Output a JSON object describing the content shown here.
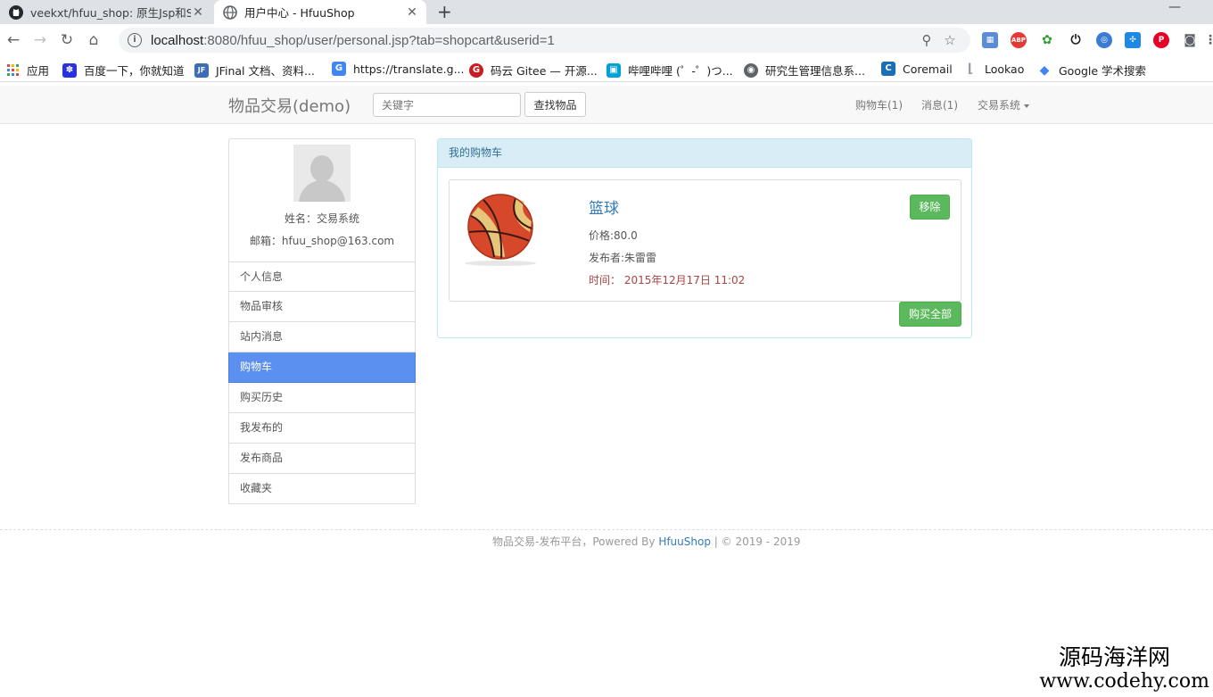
{
  "browser": {
    "tabs": [
      {
        "title": "veekxt/hfuu_shop: 原生Jsp和Se",
        "icon": "github-icon"
      },
      {
        "title": "用户中心 - HfuuShop",
        "icon": "globe-icon"
      }
    ],
    "new_tab": "+",
    "minimize": "—",
    "close_glyph": "✕",
    "url_host": "localhost",
    "url_rest": ":8080/hfuu_shop/user/personal.jsp?tab=shopcart&userid=1",
    "bookmarks": [
      {
        "label": "应用",
        "icon": "apps-grid-icon",
        "color": "#e8453c"
      },
      {
        "label": "百度一下，你就知道",
        "icon": "baidu-paw-icon",
        "color": "#2932e1"
      },
      {
        "label": "JFinal 文档、资料...",
        "icon": "jfinal-icon",
        "color": "#3b6eb5"
      },
      {
        "label": "https://translate.g...",
        "icon": "translate-icon",
        "color": "#4285f4"
      },
      {
        "label": "码云 Gitee — 开源...",
        "icon": "gitee-icon",
        "color": "#c71d23"
      },
      {
        "label": "哔哩哔哩 (゜-゜)つ...",
        "icon": "bilibili-icon",
        "color": "#00a1d6"
      },
      {
        "label": "研究生管理信息系...",
        "icon": "globe-icon",
        "color": "#5f6368"
      },
      {
        "label": "Coremail",
        "icon": "coremail-icon",
        "color": "#1a6eb5"
      },
      {
        "label": "Lookao",
        "icon": "lookao-icon",
        "color": "#9aa0a6"
      },
      {
        "label": "Google 学术搜索",
        "icon": "scholar-icon",
        "color": "#4285f4"
      }
    ]
  },
  "site": {
    "brand": "物品交易(demo)",
    "search_placeholder": "关键字",
    "search_button": "查找物品",
    "nav": {
      "cart": "购物车(1)",
      "messages": "消息(1)",
      "system": "交易系统"
    }
  },
  "profile": {
    "name": "姓名：交易系统",
    "email": "邮箱：hfuu_shop@163.com",
    "menu": [
      "个人信息",
      "物品审核",
      "站内消息",
      "购物车",
      "购买历史",
      "我发布的",
      "发布商品",
      "收藏夹"
    ],
    "active_menu": "购物车"
  },
  "cart": {
    "heading": "我的购物车",
    "items": [
      {
        "name": "篮球",
        "price": "价格:80.0",
        "seller": "发布者:朱雷雷",
        "time": "时间： 2015年12月17日 11:02",
        "remove_label": "移除",
        "image": "basketball-image"
      }
    ],
    "buy_all": "购买全部"
  },
  "footer": {
    "text": "物品交易-发布平台，Powered By ",
    "link": "HfuuShop",
    "suffix": " | © 2019 - 2019"
  },
  "watermark": {
    "line1": "源码海洋网",
    "line2": "www.codehy.com"
  },
  "colors": {
    "active_menu": "#5b8ff0",
    "success": "#5cb85c",
    "panel_heading": "#d9edf7",
    "link": "#337ab7"
  }
}
